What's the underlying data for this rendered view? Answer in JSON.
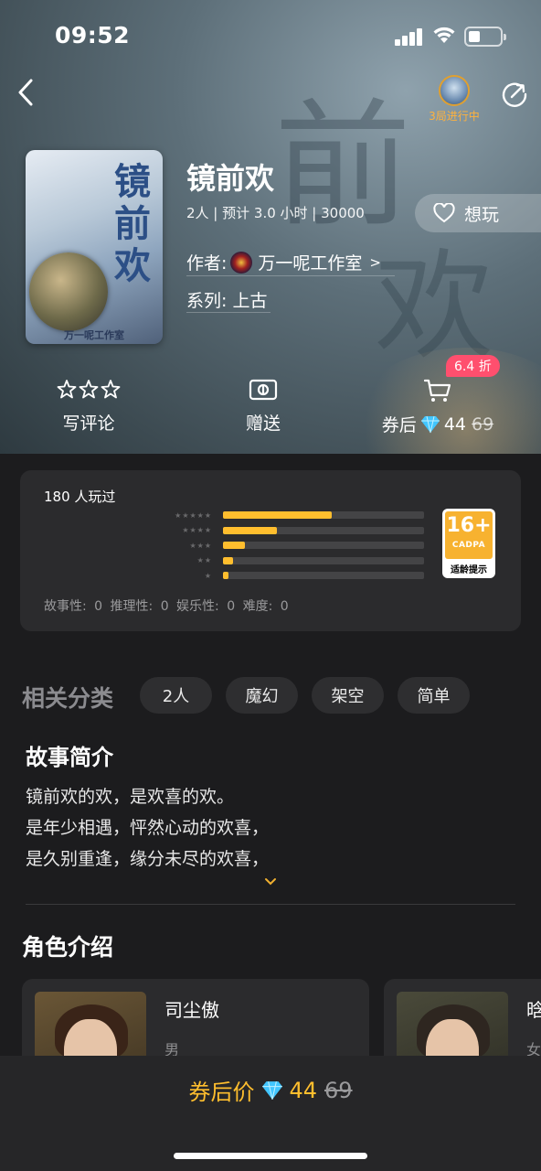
{
  "status_bar": {
    "time": "09:52"
  },
  "header": {
    "live_status": "3局进行中"
  },
  "game": {
    "cover_title_chars": [
      "镜",
      "前",
      "欢"
    ],
    "cover_brand": "万一呢工作室",
    "title": "镜前欢",
    "meta": "2人 | 预计 3.0 小时 | 30000",
    "want_label": "想玩",
    "author_label": "作者: ",
    "author_name": "万一呢工作室",
    "author_arrow": ">",
    "series": "系列: 上古"
  },
  "actions": {
    "review_label": "写评论",
    "gift_label": "赠送",
    "discount_badge": "6.4 折",
    "coupon_label": "券后",
    "price": "44",
    "original_price": "69"
  },
  "stats": {
    "played": "180 人玩过",
    "ratings": [
      {
        "stars": "★★★★★",
        "fraction": 0.54
      },
      {
        "stars": "★★★★",
        "fraction": 0.27
      },
      {
        "stars": "★★★",
        "fraction": 0.11
      },
      {
        "stars": "★★",
        "fraction": 0.05
      },
      {
        "stars": "★",
        "fraction": 0.025
      }
    ],
    "age_rating": "16+",
    "age_org": "CADPA",
    "age_tip": "适龄提示",
    "scores": "故事性: 0  推理性: 0  娱乐性: 0  难度: 0"
  },
  "categories": {
    "title": "相关分类",
    "tags": [
      "2人",
      "魔幻",
      "架空",
      "简单"
    ]
  },
  "story": {
    "title": "故事简介",
    "lines": [
      "镜前欢的欢，是欢喜的欢。",
      "是年少相遇，怦然心动的欢喜，",
      "是久别重逢，缘分未尽的欢喜，"
    ]
  },
  "roles": {
    "title": "角色介绍",
    "items": [
      {
        "name": "司尘傲",
        "gender": "男"
      },
      {
        "name": "晗",
        "gender": "女"
      }
    ]
  },
  "bottom": {
    "label": "券后价",
    "price": "44",
    "original_price": "69"
  },
  "colors": {
    "accent": "#ffbe2e",
    "discount": "#ff4f6e",
    "background": "#1c1c1e",
    "card": "#2b2b2d"
  }
}
